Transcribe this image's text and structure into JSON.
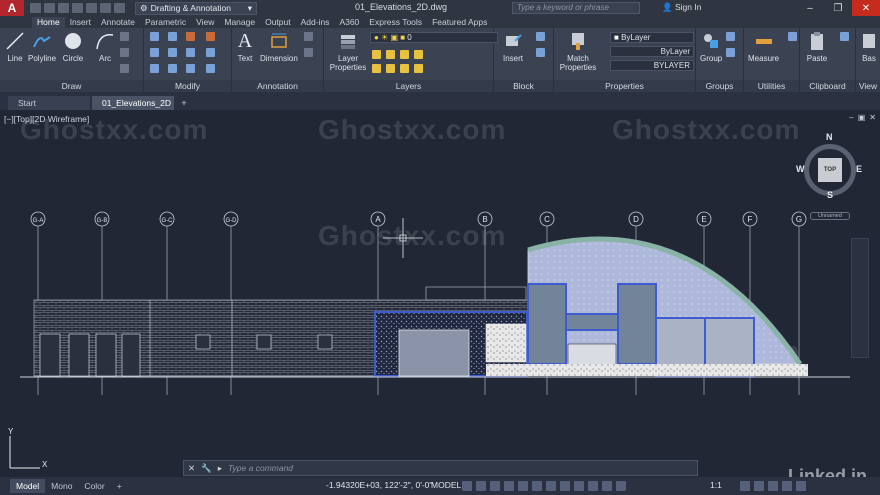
{
  "titlebar": {
    "app_logo": "A",
    "workspace": "Drafting & Annotation",
    "document_title": "01_Elevations_2D.dwg",
    "search_placeholder": "Type a keyword or phrase",
    "sign_in": "Sign In"
  },
  "ribbon_tabs": [
    "Home",
    "Insert",
    "Annotate",
    "Parametric",
    "View",
    "Manage",
    "Output",
    "Add-ins",
    "A360",
    "Express Tools",
    "Featured Apps"
  ],
  "ribbon": {
    "draw": {
      "label": "Draw",
      "tools": [
        "Line",
        "Polyline",
        "Circle",
        "Arc"
      ]
    },
    "modify": {
      "label": "Modify"
    },
    "annotation": {
      "label": "Annotation",
      "tools": [
        "Text",
        "Dimension"
      ]
    },
    "layers": {
      "label": "Layers",
      "layer_properties": "Layer Properties",
      "current_layer": "0"
    },
    "block": {
      "label": "Block",
      "insert": "Insert"
    },
    "properties": {
      "label": "Properties",
      "match": "Match Properties",
      "color": "ByLayer",
      "linetype": "ByLayer",
      "lineweight": "BYLAYER"
    },
    "groups": {
      "label": "Groups",
      "group": "Group"
    },
    "utilities": {
      "label": "Utilities",
      "measure": "Measure"
    },
    "clipboard": {
      "label": "Clipboard",
      "paste": "Paste"
    },
    "view": {
      "label": "View",
      "base": "Bas"
    }
  },
  "file_tabs": [
    {
      "label": "Start",
      "active": false
    },
    {
      "label": "01_Elevations_2D",
      "active": true
    }
  ],
  "viewport": {
    "label": "[−][Top][2D Wireframe]",
    "viewcube": {
      "top": "TOP",
      "n": "N",
      "s": "S",
      "e": "E",
      "w": "W",
      "ucs_name": "Unnamed"
    },
    "grid_bubbles": [
      "G-A",
      "G-B",
      "G-C",
      "G-D",
      "A",
      "B",
      "C",
      "D",
      "E",
      "F",
      "G"
    ],
    "ucs_y": "Y",
    "ucs_x": "X"
  },
  "watermark": "Ghostxx.com",
  "command_line": {
    "placeholder": "Type a command"
  },
  "status": {
    "layout_tabs": [
      "Model",
      "Mono",
      "Color"
    ],
    "coordinates": "-1.94320E+03, 122'-2\", 0'-0\"",
    "space": "MODEL",
    "scale": "1:1"
  },
  "branding": "Linked in"
}
